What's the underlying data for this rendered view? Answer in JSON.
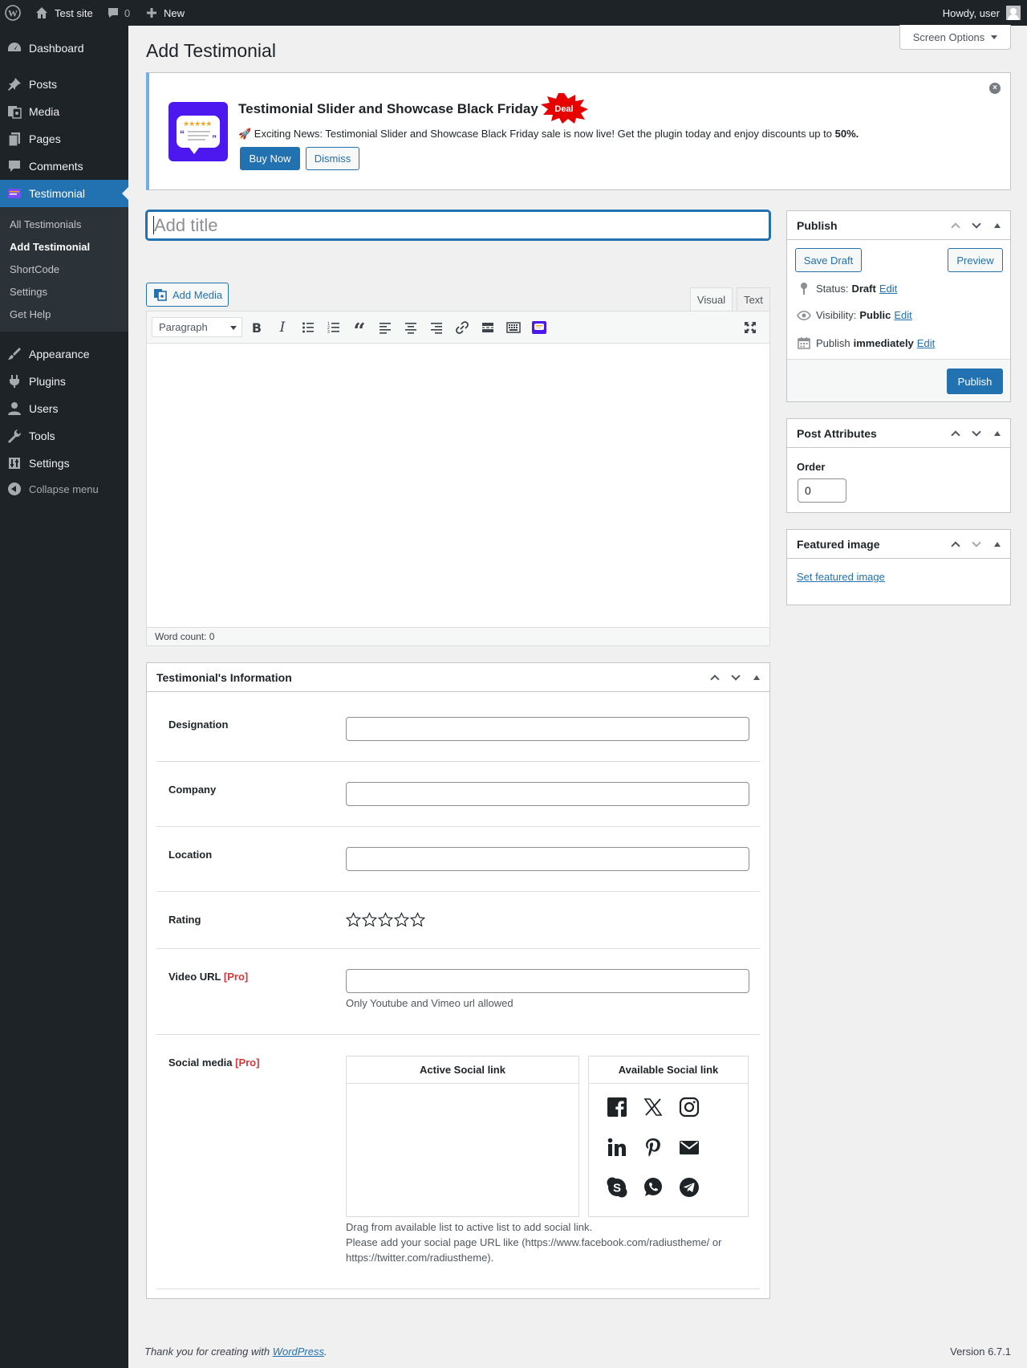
{
  "admin_bar": {
    "site_name": "Test site",
    "comments_count": "0",
    "new_label": "New",
    "howdy": "Howdy, user"
  },
  "sidebar": {
    "items": [
      {
        "label": "Dashboard",
        "icon": "dashboard-icon"
      },
      {
        "label": "Posts",
        "icon": "pin-icon"
      },
      {
        "label": "Media",
        "icon": "media-icon"
      },
      {
        "label": "Pages",
        "icon": "pages-icon"
      },
      {
        "label": "Comments",
        "icon": "comment-icon"
      },
      {
        "label": "Testimonial",
        "icon": "testimonial-icon",
        "current": true
      },
      {
        "label": "Appearance",
        "icon": "brush-icon"
      },
      {
        "label": "Plugins",
        "icon": "plug-icon"
      },
      {
        "label": "Users",
        "icon": "user-icon"
      },
      {
        "label": "Tools",
        "icon": "wrench-icon"
      },
      {
        "label": "Settings",
        "icon": "settings-icon"
      }
    ],
    "submenu": [
      "All Testimonials",
      "Add Testimonial",
      "ShortCode",
      "Settings",
      "Get Help"
    ],
    "collapse_label": "Collapse menu"
  },
  "screen_options": "Screen Options",
  "page_title": "Add Testimonial",
  "notice": {
    "title": "Testimonial Slider and Showcase Black Friday",
    "deal_badge": "Deal",
    "message": "🚀 Exciting News: Testimonial Slider and Showcase Black Friday sale is now live! Get the plugin today and enjoy discounts up to ",
    "message_bold": "50%.",
    "buy_label": "Buy Now",
    "dismiss_label": "Dismiss"
  },
  "title_placeholder": "Add title",
  "editor": {
    "add_media": "Add Media",
    "tab_visual": "Visual",
    "tab_text": "Text",
    "format": "Paragraph",
    "word_count": "Word count: 0"
  },
  "publish": {
    "heading": "Publish",
    "save_draft": "Save Draft",
    "preview": "Preview",
    "status_label": "Status:",
    "status_value": "Draft",
    "visibility_label": "Visibility:",
    "visibility_value": "Public",
    "publish_label": "Publish",
    "publish_value": "immediately",
    "edit": "Edit",
    "publish_button": "Publish"
  },
  "post_attributes": {
    "heading": "Post Attributes",
    "order_label": "Order",
    "order_value": "0"
  },
  "featured_image": {
    "heading": "Featured image",
    "link": "Set featured image"
  },
  "info": {
    "heading": "Testimonial's Information",
    "designation": "Designation",
    "company": "Company",
    "location": "Location",
    "rating": "Rating",
    "rating_value": 0,
    "rating_max": 5,
    "video_url": "Video URL",
    "pro": "[Pro]",
    "video_hint": "Only Youtube and Vimeo url allowed",
    "social_media": "Social media",
    "active_social": "Active Social link",
    "available_social": "Available Social link",
    "social_icons": [
      "facebook-icon",
      "x-icon",
      "instagram-icon",
      "linkedin-icon",
      "pinterest-icon",
      "email-icon",
      "skype-icon",
      "whatsapp-icon",
      "telegram-icon"
    ],
    "social_hint1": "Drag from available list to active list to add social link.",
    "social_hint2": "Please add your social page URL like (https://www.facebook.com/radiustheme/ or",
    "social_hint3": "https://twitter.com/radiustheme)."
  },
  "footer": {
    "thanks": "Thank you for creating with ",
    "link": "WordPress",
    "period": ".",
    "version": "Version 6.7.1"
  },
  "colors": {
    "accent": "#2271b1",
    "admin_dark": "#1d2327",
    "pro_red": "#d63638",
    "notice_border": "#72aee6"
  }
}
